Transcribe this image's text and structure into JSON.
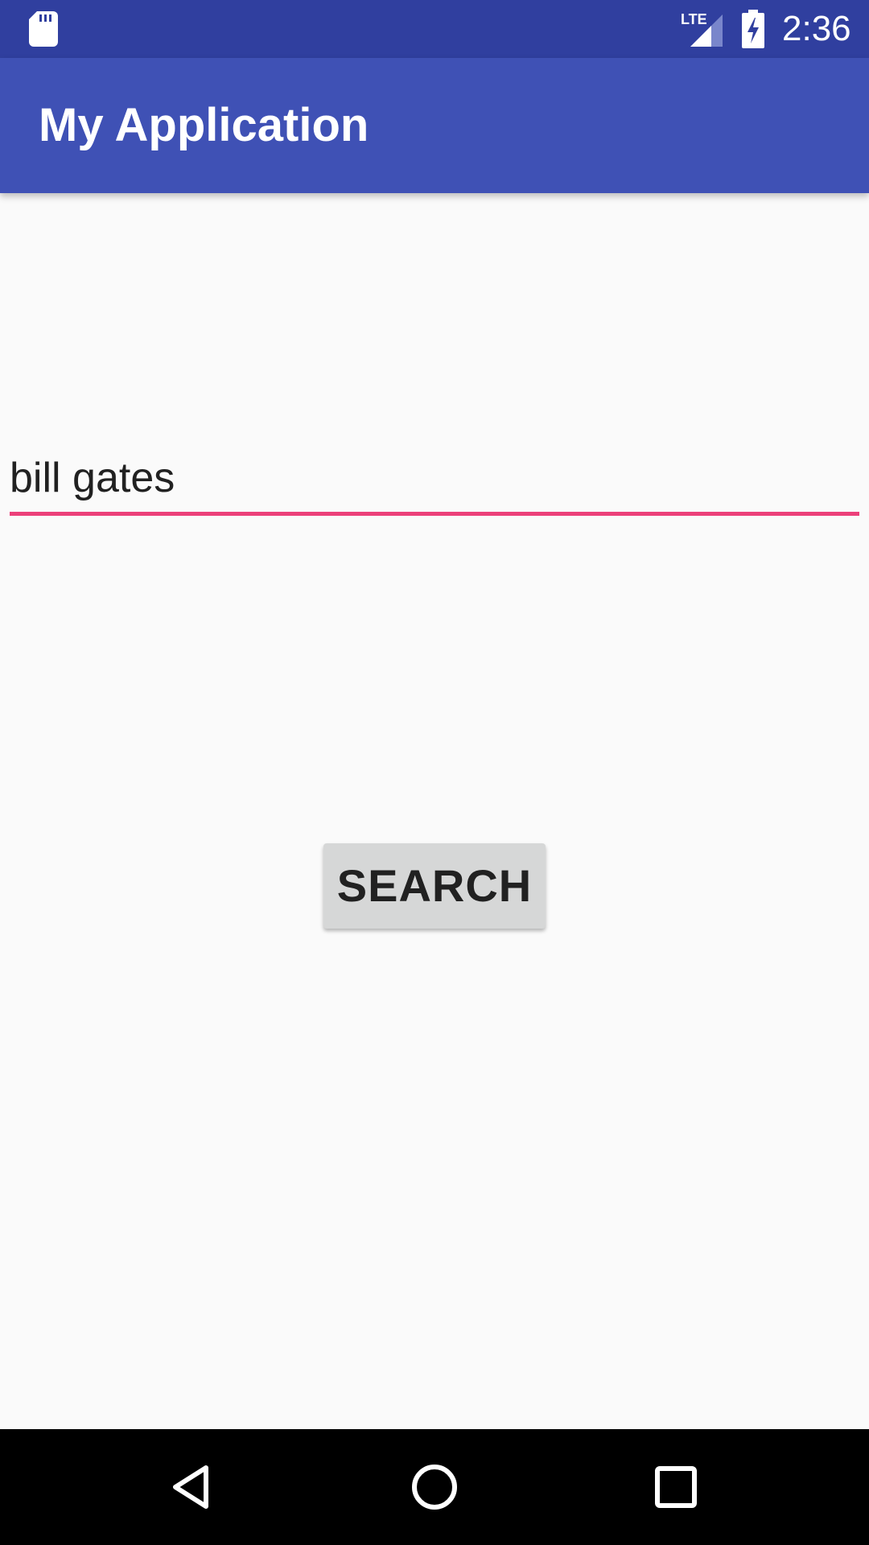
{
  "status_bar": {
    "time": "2:36",
    "network_label": "LTE",
    "icons": [
      "sd-card-icon",
      "lte-signal-icon",
      "battery-charging-icon"
    ],
    "background_color": "#303F9F"
  },
  "app_bar": {
    "title": "My Application",
    "background_color": "#3F51B5"
  },
  "search": {
    "input_value": "bill gates",
    "underline_color": "#EC407A",
    "button_label": "SEARCH"
  },
  "nav_bar": {
    "icons": [
      "back-icon",
      "home-icon",
      "recents-icon"
    ]
  }
}
